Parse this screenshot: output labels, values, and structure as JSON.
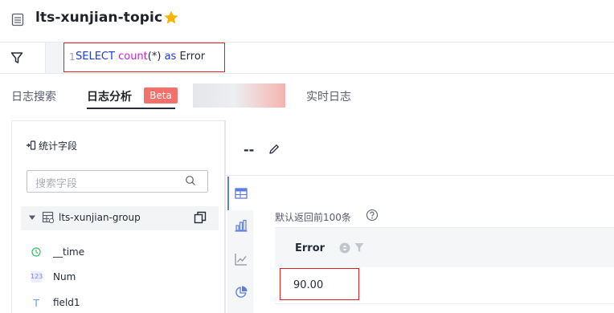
{
  "header": {
    "title": "lts-xunjian-topic"
  },
  "query": {
    "line_number": "1",
    "keyword_select": "SELECT",
    "function_name": "count",
    "arg": "(*)",
    "keyword_as": "as",
    "alias": "Error"
  },
  "tabs": [
    {
      "label": "日志搜索"
    },
    {
      "label": "日志分析"
    },
    {
      "label": "实时日志"
    }
  ],
  "beta_badge": "Beta",
  "left_panel": {
    "stats_label": "统计字段",
    "search_placeholder": "搜索字段",
    "group_name": "lts-xunjian-group",
    "fields": [
      {
        "icon_text": "",
        "label": "__time",
        "icon": "clock-icon",
        "color": "#3fc26b"
      },
      {
        "icon_text": "123",
        "label": "Num",
        "icon": "number-icon",
        "color": "#7c83f5"
      },
      {
        "icon_text": "T",
        "label": "field1",
        "icon": "text-icon",
        "color": "#5e9cf0"
      }
    ]
  },
  "chart_panel": {
    "title": "--",
    "result_note": "默认返回前100条",
    "table": {
      "columns": [
        "Error"
      ],
      "rows": [
        [
          "90.00"
        ]
      ]
    }
  },
  "colors": {
    "highlight": "#e02020",
    "beta": "#f6706b",
    "star": "#f7b500",
    "accent": "#5e7ce0"
  }
}
